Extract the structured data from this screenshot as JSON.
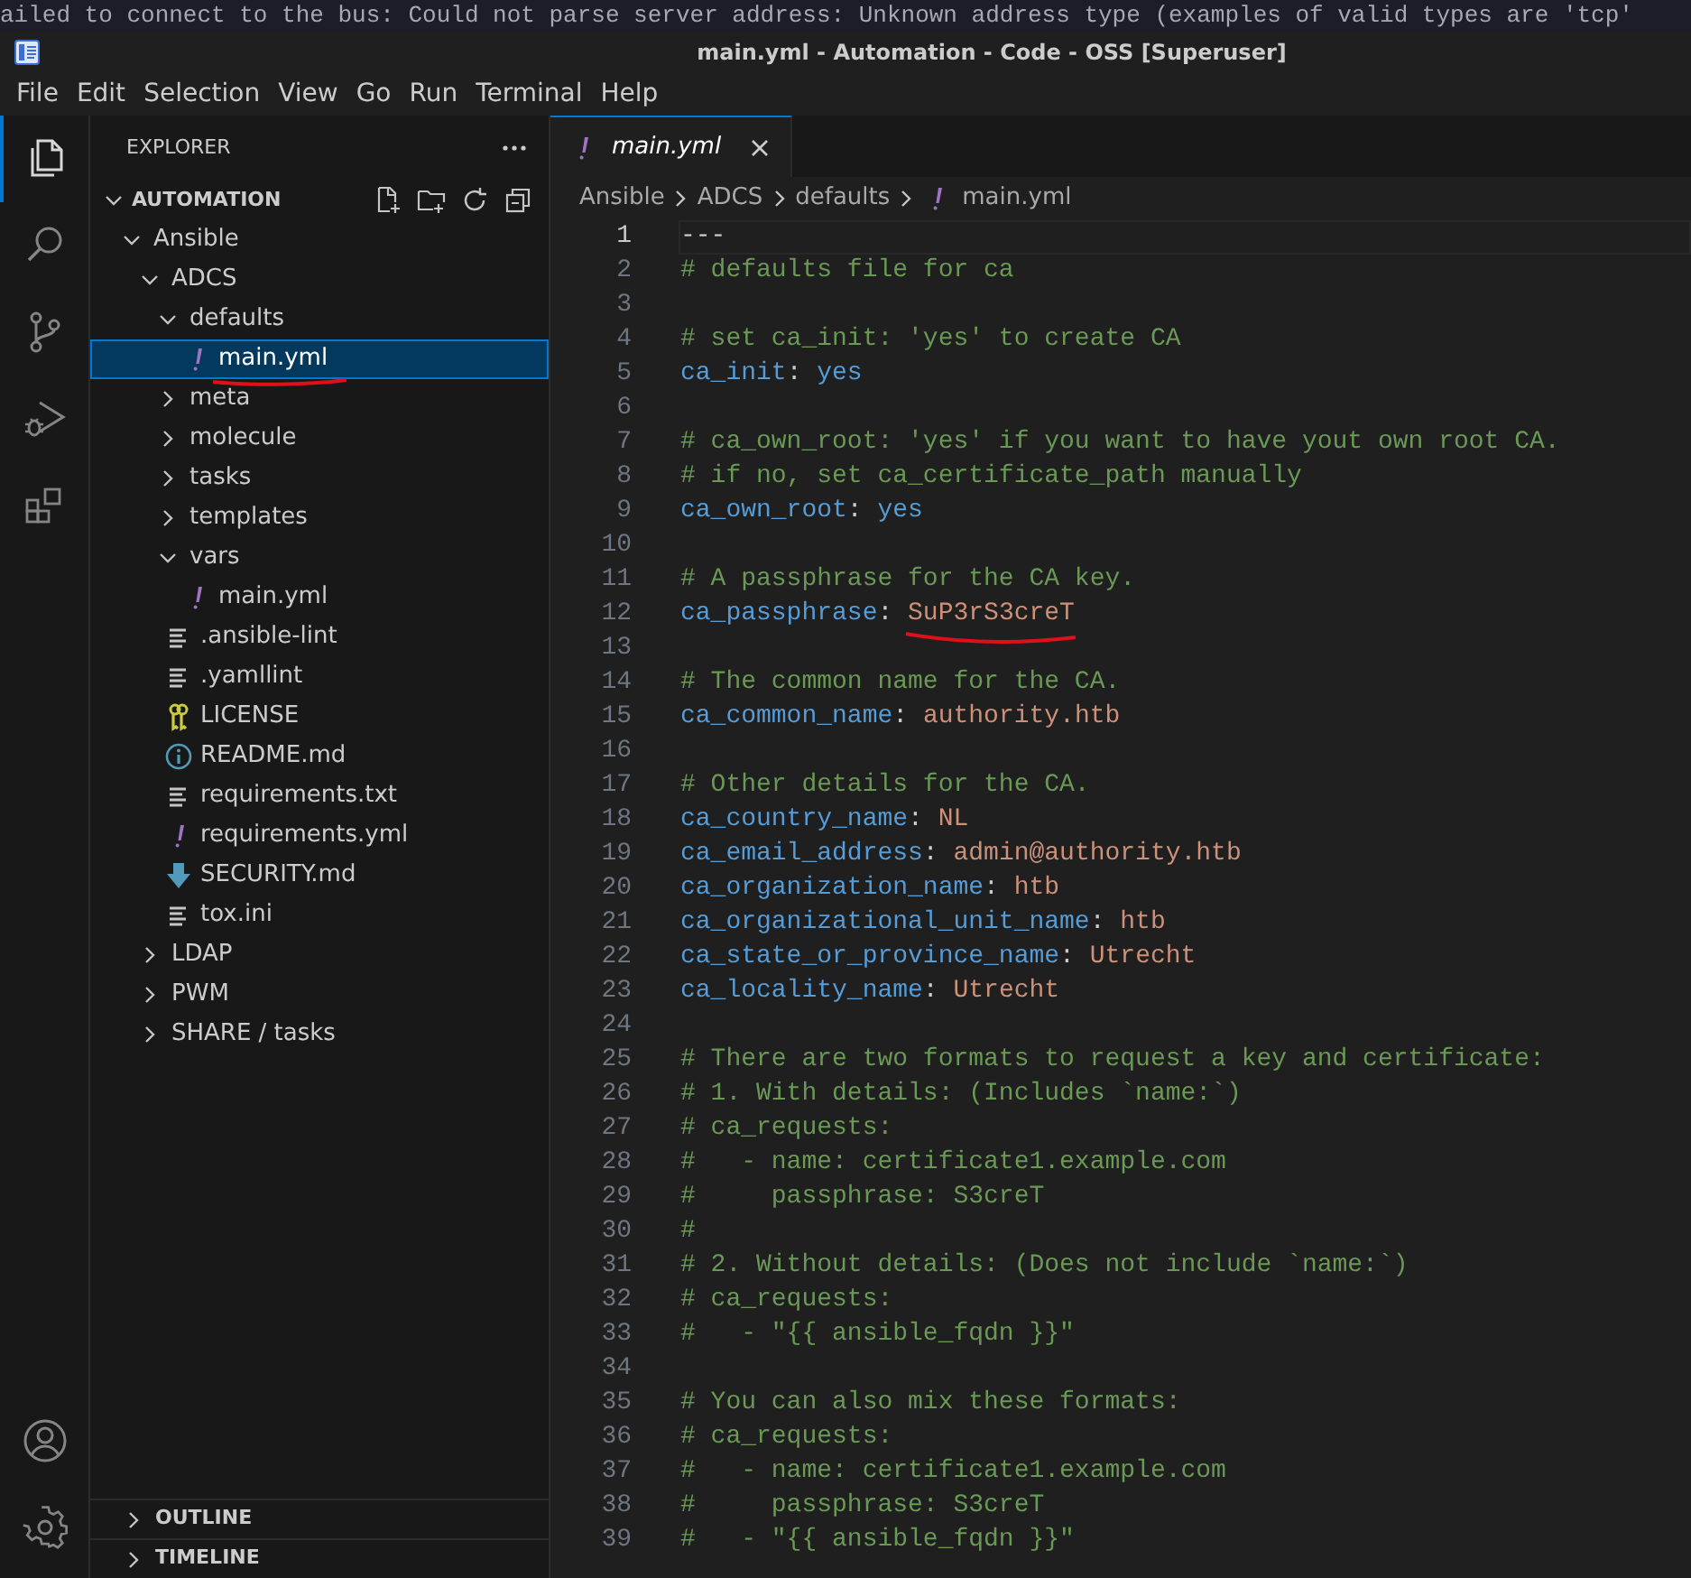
{
  "terminal_message": "ailed to connect to the bus: Could not parse server address: Unknown address type (examples of valid types are 'tcp'",
  "window": {
    "title": "main.yml - Automation - Code - OSS [Superuser]"
  },
  "menu": [
    "File",
    "Edit",
    "Selection",
    "View",
    "Go",
    "Run",
    "Terminal",
    "Help"
  ],
  "activity_bar": {
    "items": [
      {
        "selected": true
      },
      {
        "selected": false
      },
      {
        "selected": false
      },
      {
        "selected": false
      },
      {
        "selected": false
      }
    ]
  },
  "explorer": {
    "title": "EXPLORER",
    "root": {
      "label": "AUTOMATION",
      "expanded": true,
      "children": [
        {
          "kind": "folder",
          "label": "Ansible",
          "expanded": true,
          "selected": false,
          "underlined": false,
          "children": [
            {
              "kind": "folder",
              "label": "ADCS",
              "expanded": true,
              "selected": false,
              "underlined": false,
              "children": [
                {
                  "kind": "folder",
                  "label": "defaults",
                  "expanded": true,
                  "selected": false,
                  "underlined": false,
                  "children": [
                    {
                      "kind": "yaml",
                      "label": "main.yml",
                      "selected": true,
                      "underlined": true
                    }
                  ]
                },
                {
                  "kind": "folder",
                  "label": "meta",
                  "expanded": false,
                  "selected": false,
                  "underlined": false
                },
                {
                  "kind": "folder",
                  "label": "molecule",
                  "expanded": false,
                  "selected": false,
                  "underlined": false
                },
                {
                  "kind": "folder",
                  "label": "tasks",
                  "expanded": false,
                  "selected": false,
                  "underlined": false
                },
                {
                  "kind": "folder",
                  "label": "templates",
                  "expanded": false,
                  "selected": false,
                  "underlined": false
                },
                {
                  "kind": "folder",
                  "label": "vars",
                  "expanded": true,
                  "selected": false,
                  "underlined": false,
                  "children": [
                    {
                      "kind": "yaml",
                      "label": "main.yml",
                      "selected": false,
                      "underlined": false
                    }
                  ]
                },
                {
                  "kind": "text",
                  "label": ".ansible-lint",
                  "selected": false,
                  "underlined": false
                },
                {
                  "kind": "text",
                  "label": ".yamllint",
                  "selected": false,
                  "underlined": false
                },
                {
                  "kind": "license",
                  "label": "LICENSE",
                  "selected": false,
                  "underlined": false
                },
                {
                  "kind": "info",
                  "label": "README.md",
                  "selected": false,
                  "underlined": false
                },
                {
                  "kind": "text",
                  "label": "requirements.txt",
                  "selected": false,
                  "underlined": false
                },
                {
                  "kind": "yaml",
                  "label": "requirements.yml",
                  "selected": false,
                  "underlined": false
                },
                {
                  "kind": "security",
                  "label": "SECURITY.md",
                  "selected": false,
                  "underlined": false
                },
                {
                  "kind": "text",
                  "label": "tox.ini",
                  "selected": false,
                  "underlined": false
                }
              ]
            },
            {
              "kind": "folder",
              "label": "LDAP",
              "expanded": false,
              "selected": false,
              "underlined": false
            },
            {
              "kind": "folder",
              "label": "PWM",
              "expanded": false,
              "selected": false,
              "underlined": false
            },
            {
              "kind": "folder",
              "label": "SHARE / tasks",
              "expanded": false,
              "selected": false,
              "underlined": false
            }
          ]
        }
      ]
    }
  },
  "panels": [
    {
      "label": "OUTLINE",
      "expanded": false
    },
    {
      "label": "TIMELINE",
      "expanded": false
    }
  ],
  "editor": {
    "tabs": [
      {
        "label": "main.yml",
        "kind": "yaml",
        "selected": true
      }
    ],
    "breadcrumbs": [
      {
        "label": "Ansible"
      },
      {
        "label": "ADCS"
      },
      {
        "label": "defaults"
      },
      {
        "label": "main.yml",
        "kind": "yaml"
      }
    ],
    "lines": [
      {
        "number": "1",
        "current": true,
        "tokens": [
          {
            "kind": "plain",
            "text": "---"
          }
        ]
      },
      {
        "number": "2",
        "current": false,
        "tokens": [
          {
            "kind": "comment",
            "text": "# defaults file for ca"
          }
        ]
      },
      {
        "number": "3",
        "current": false
      },
      {
        "number": "4",
        "current": false,
        "tokens": [
          {
            "kind": "comment",
            "text": "# set ca_init: 'yes' to create CA"
          }
        ]
      },
      {
        "number": "5",
        "current": false,
        "tokens": [
          {
            "kind": "key",
            "text": "ca_init"
          },
          {
            "kind": "plain",
            "text": ": "
          },
          {
            "kind": "bool",
            "text": "yes"
          }
        ]
      },
      {
        "number": "6",
        "current": false
      },
      {
        "number": "7",
        "current": false,
        "tokens": [
          {
            "kind": "comment",
            "text": "# ca_own_root: 'yes' if you want to have yout own root CA."
          }
        ]
      },
      {
        "number": "8",
        "current": false,
        "tokens": [
          {
            "kind": "comment",
            "text": "# if no, set ca_certificate_path manually"
          }
        ]
      },
      {
        "number": "9",
        "current": false,
        "tokens": [
          {
            "kind": "key",
            "text": "ca_own_root"
          },
          {
            "kind": "plain",
            "text": ": "
          },
          {
            "kind": "bool",
            "text": "yes"
          }
        ]
      },
      {
        "number": "10",
        "current": false
      },
      {
        "number": "11",
        "current": false,
        "tokens": [
          {
            "kind": "comment",
            "text": "# A passphrase for the CA key."
          }
        ]
      },
      {
        "number": "12",
        "current": false,
        "tokens": [
          {
            "kind": "key",
            "text": "ca_passphrase"
          },
          {
            "kind": "plain",
            "text": ": "
          },
          {
            "kind": "string",
            "text": "SuP3rS3creT",
            "underlined": true
          }
        ]
      },
      {
        "number": "13",
        "current": false
      },
      {
        "number": "14",
        "current": false,
        "tokens": [
          {
            "kind": "comment",
            "text": "# The common name for the CA."
          }
        ]
      },
      {
        "number": "15",
        "current": false,
        "tokens": [
          {
            "kind": "key",
            "text": "ca_common_name"
          },
          {
            "kind": "plain",
            "text": ": "
          },
          {
            "kind": "string",
            "text": "authority.htb"
          }
        ]
      },
      {
        "number": "16",
        "current": false
      },
      {
        "number": "17",
        "current": false,
        "tokens": [
          {
            "kind": "comment",
            "text": "# Other details for the CA."
          }
        ]
      },
      {
        "number": "18",
        "current": false,
        "tokens": [
          {
            "kind": "key",
            "text": "ca_country_name"
          },
          {
            "kind": "plain",
            "text": ": "
          },
          {
            "kind": "string",
            "text": "NL"
          }
        ]
      },
      {
        "number": "19",
        "current": false,
        "tokens": [
          {
            "kind": "key",
            "text": "ca_email_address"
          },
          {
            "kind": "plain",
            "text": ": "
          },
          {
            "kind": "string",
            "text": "admin@authority.htb"
          }
        ]
      },
      {
        "number": "20",
        "current": false,
        "tokens": [
          {
            "kind": "key",
            "text": "ca_organization_name"
          },
          {
            "kind": "plain",
            "text": ": "
          },
          {
            "kind": "string",
            "text": "htb"
          }
        ]
      },
      {
        "number": "21",
        "current": false,
        "tokens": [
          {
            "kind": "key",
            "text": "ca_organizational_unit_name"
          },
          {
            "kind": "plain",
            "text": ": "
          },
          {
            "kind": "string",
            "text": "htb"
          }
        ]
      },
      {
        "number": "22",
        "current": false,
        "tokens": [
          {
            "kind": "key",
            "text": "ca_state_or_province_name"
          },
          {
            "kind": "plain",
            "text": ": "
          },
          {
            "kind": "string",
            "text": "Utrecht"
          }
        ]
      },
      {
        "number": "23",
        "current": false,
        "tokens": [
          {
            "kind": "key",
            "text": "ca_locality_name"
          },
          {
            "kind": "plain",
            "text": ": "
          },
          {
            "kind": "string",
            "text": "Utrecht"
          }
        ]
      },
      {
        "number": "24",
        "current": false
      },
      {
        "number": "25",
        "current": false,
        "tokens": [
          {
            "kind": "comment",
            "text": "# There are two formats to request a key and certificate:"
          }
        ]
      },
      {
        "number": "26",
        "current": false,
        "tokens": [
          {
            "kind": "comment",
            "text": "# 1. With details: (Includes `name:`)"
          }
        ]
      },
      {
        "number": "27",
        "current": false,
        "tokens": [
          {
            "kind": "comment",
            "text": "# ca_requests:"
          }
        ]
      },
      {
        "number": "28",
        "current": false,
        "tokens": [
          {
            "kind": "comment",
            "text": "#   - name: certificate1.example.com"
          }
        ]
      },
      {
        "number": "29",
        "current": false,
        "tokens": [
          {
            "kind": "comment",
            "text": "#     passphrase: S3creT"
          }
        ]
      },
      {
        "number": "30",
        "current": false,
        "tokens": [
          {
            "kind": "comment",
            "text": "#"
          }
        ]
      },
      {
        "number": "31",
        "current": false,
        "tokens": [
          {
            "kind": "comment",
            "text": "# 2. Without details: (Does not include `name:`)"
          }
        ]
      },
      {
        "number": "32",
        "current": false,
        "tokens": [
          {
            "kind": "comment",
            "text": "# ca_requests:"
          }
        ]
      },
      {
        "number": "33",
        "current": false,
        "tokens": [
          {
            "kind": "comment",
            "text": "#   - \"{{ ansible_fqdn }}\""
          }
        ]
      },
      {
        "number": "34",
        "current": false
      },
      {
        "number": "35",
        "current": false,
        "tokens": [
          {
            "kind": "comment",
            "text": "# You can also mix these formats:"
          }
        ]
      },
      {
        "number": "36",
        "current": false,
        "tokens": [
          {
            "kind": "comment",
            "text": "# ca_requests:"
          }
        ]
      },
      {
        "number": "37",
        "current": false,
        "tokens": [
          {
            "kind": "comment",
            "text": "#   - name: certificate1.example.com"
          }
        ]
      },
      {
        "number": "38",
        "current": false,
        "tokens": [
          {
            "kind": "comment",
            "text": "#     passphrase: S3creT"
          }
        ]
      },
      {
        "number": "39",
        "current": false,
        "tokens": [
          {
            "kind": "comment",
            "text": "#   - \"{{ ansible_fqdn }}\""
          }
        ]
      }
    ]
  }
}
